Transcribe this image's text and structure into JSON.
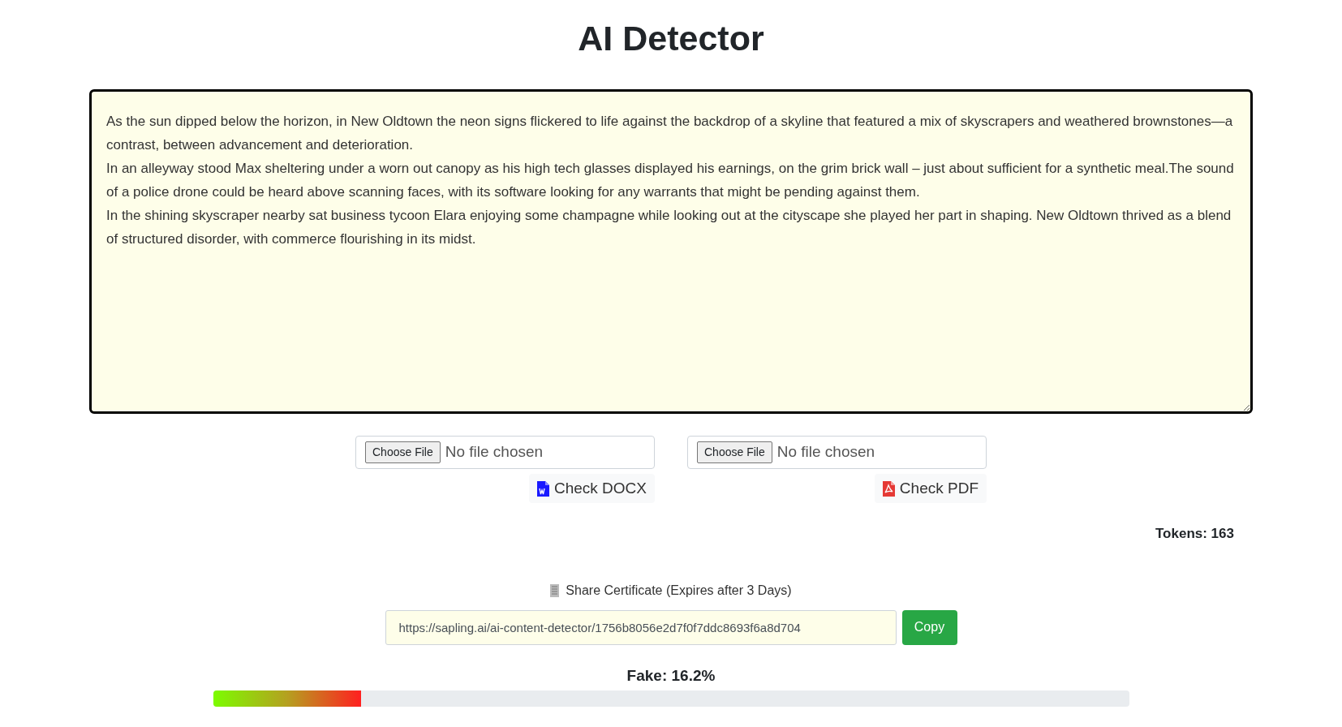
{
  "title": "AI Detector",
  "text_input": {
    "paragraphs": [
      "As the sun dipped below the horizon, in New Oldtown the neon signs flickered to life against the backdrop of a skyline that featured a mix of skyscrapers and weathered brownstones—a contrast, between advancement and deterioration.",
      "In an alleyway stood Max sheltering under a worn out canopy as his high tech glasses displayed his earnings, on the grim brick wall – just about sufficient for a synthetic meal.The sound of a police drone could be heard above scanning faces, with its software looking for any warrants that might be pending against them.",
      "In the shining skyscraper nearby sat business tycoon Elara enjoying some champagne while looking out at the cityscape she played her part in shaping. New Oldtown thrived as a blend of structured disorder, with commerce flourishing in its midst."
    ]
  },
  "uploads": [
    {
      "kind": "docx",
      "choose_label": "Choose File",
      "file_status": "No file chosen",
      "check_label": "Check DOCX"
    },
    {
      "kind": "pdf",
      "choose_label": "Choose File",
      "file_status": "No file chosen",
      "check_label": "Check PDF"
    }
  ],
  "tokens": "Tokens: 163",
  "share": {
    "label": "Share Certificate (Expires after 3 Days)",
    "url": "https://sapling.ai/ai-content-detector/1756b8056e2d7f0f7ddc8693f6a8d704",
    "copy_label": "Copy"
  },
  "result": {
    "label": "Fake: 16.2%",
    "level": 0.162
  }
}
